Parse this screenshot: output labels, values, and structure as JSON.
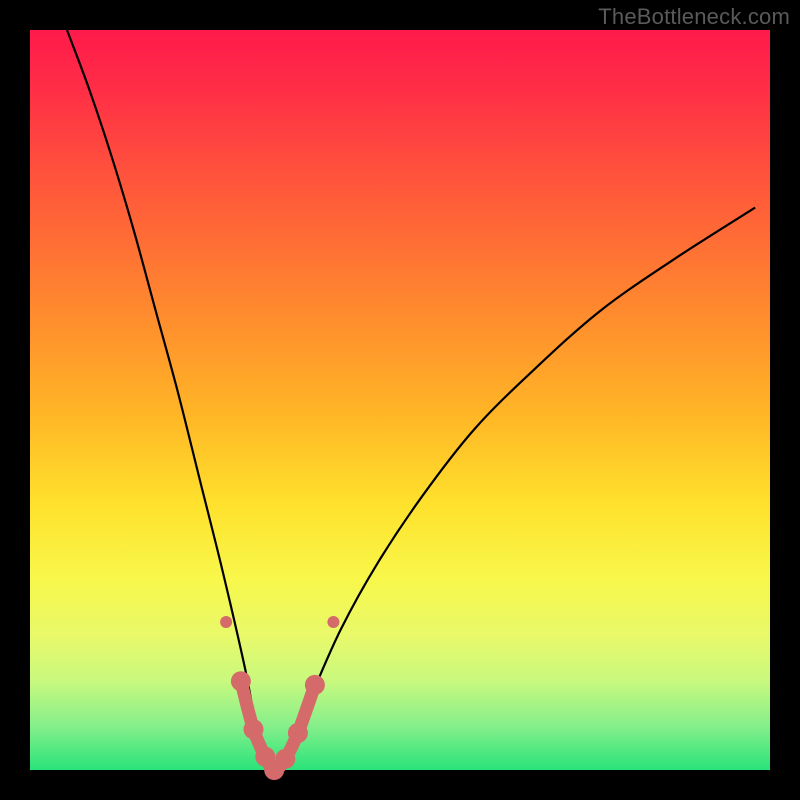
{
  "watermark": "TheBottleneck.com",
  "colors": {
    "background": "#000000",
    "curve_stroke": "#000000",
    "marker_fill": "#d46a6a",
    "marker_stroke": "#d46a6a",
    "gradient_stops": [
      "#ff1a4b",
      "#ff2e46",
      "#ff5a3a",
      "#ff8a2e",
      "#ffb626",
      "#ffe12c",
      "#f8f74a",
      "#e8f96a",
      "#c8f97e",
      "#86ef8b",
      "#29e37a"
    ]
  },
  "chart_data": {
    "type": "line",
    "title": "",
    "xlabel": "",
    "ylabel": "",
    "xlim": [
      0,
      100
    ],
    "ylim": [
      0,
      100
    ],
    "grid": false,
    "series": [
      {
        "name": "bottleneck-curve",
        "kind": "v-curve",
        "min_x": 33,
        "x": [
          5,
          8,
          11,
          14,
          17,
          20,
          23,
          26,
          29,
          31,
          33,
          35,
          38,
          42,
          47,
          53,
          60,
          68,
          77,
          87,
          98
        ],
        "y": [
          100,
          92,
          83,
          73,
          62,
          51,
          39,
          27,
          14,
          4,
          0,
          3,
          10,
          19,
          28,
          37,
          46,
          54,
          62,
          69,
          76
        ]
      }
    ],
    "markers": {
      "name": "highlight-dots",
      "x": [
        26.5,
        28.5,
        30.2,
        31.8,
        33.0,
        34.5,
        36.2,
        38.5,
        41.0
      ],
      "y": [
        20.0,
        12.0,
        5.5,
        1.8,
        0.0,
        1.5,
        5.0,
        11.5,
        20.0
      ],
      "size_main": 10,
      "size_end": 6
    }
  }
}
